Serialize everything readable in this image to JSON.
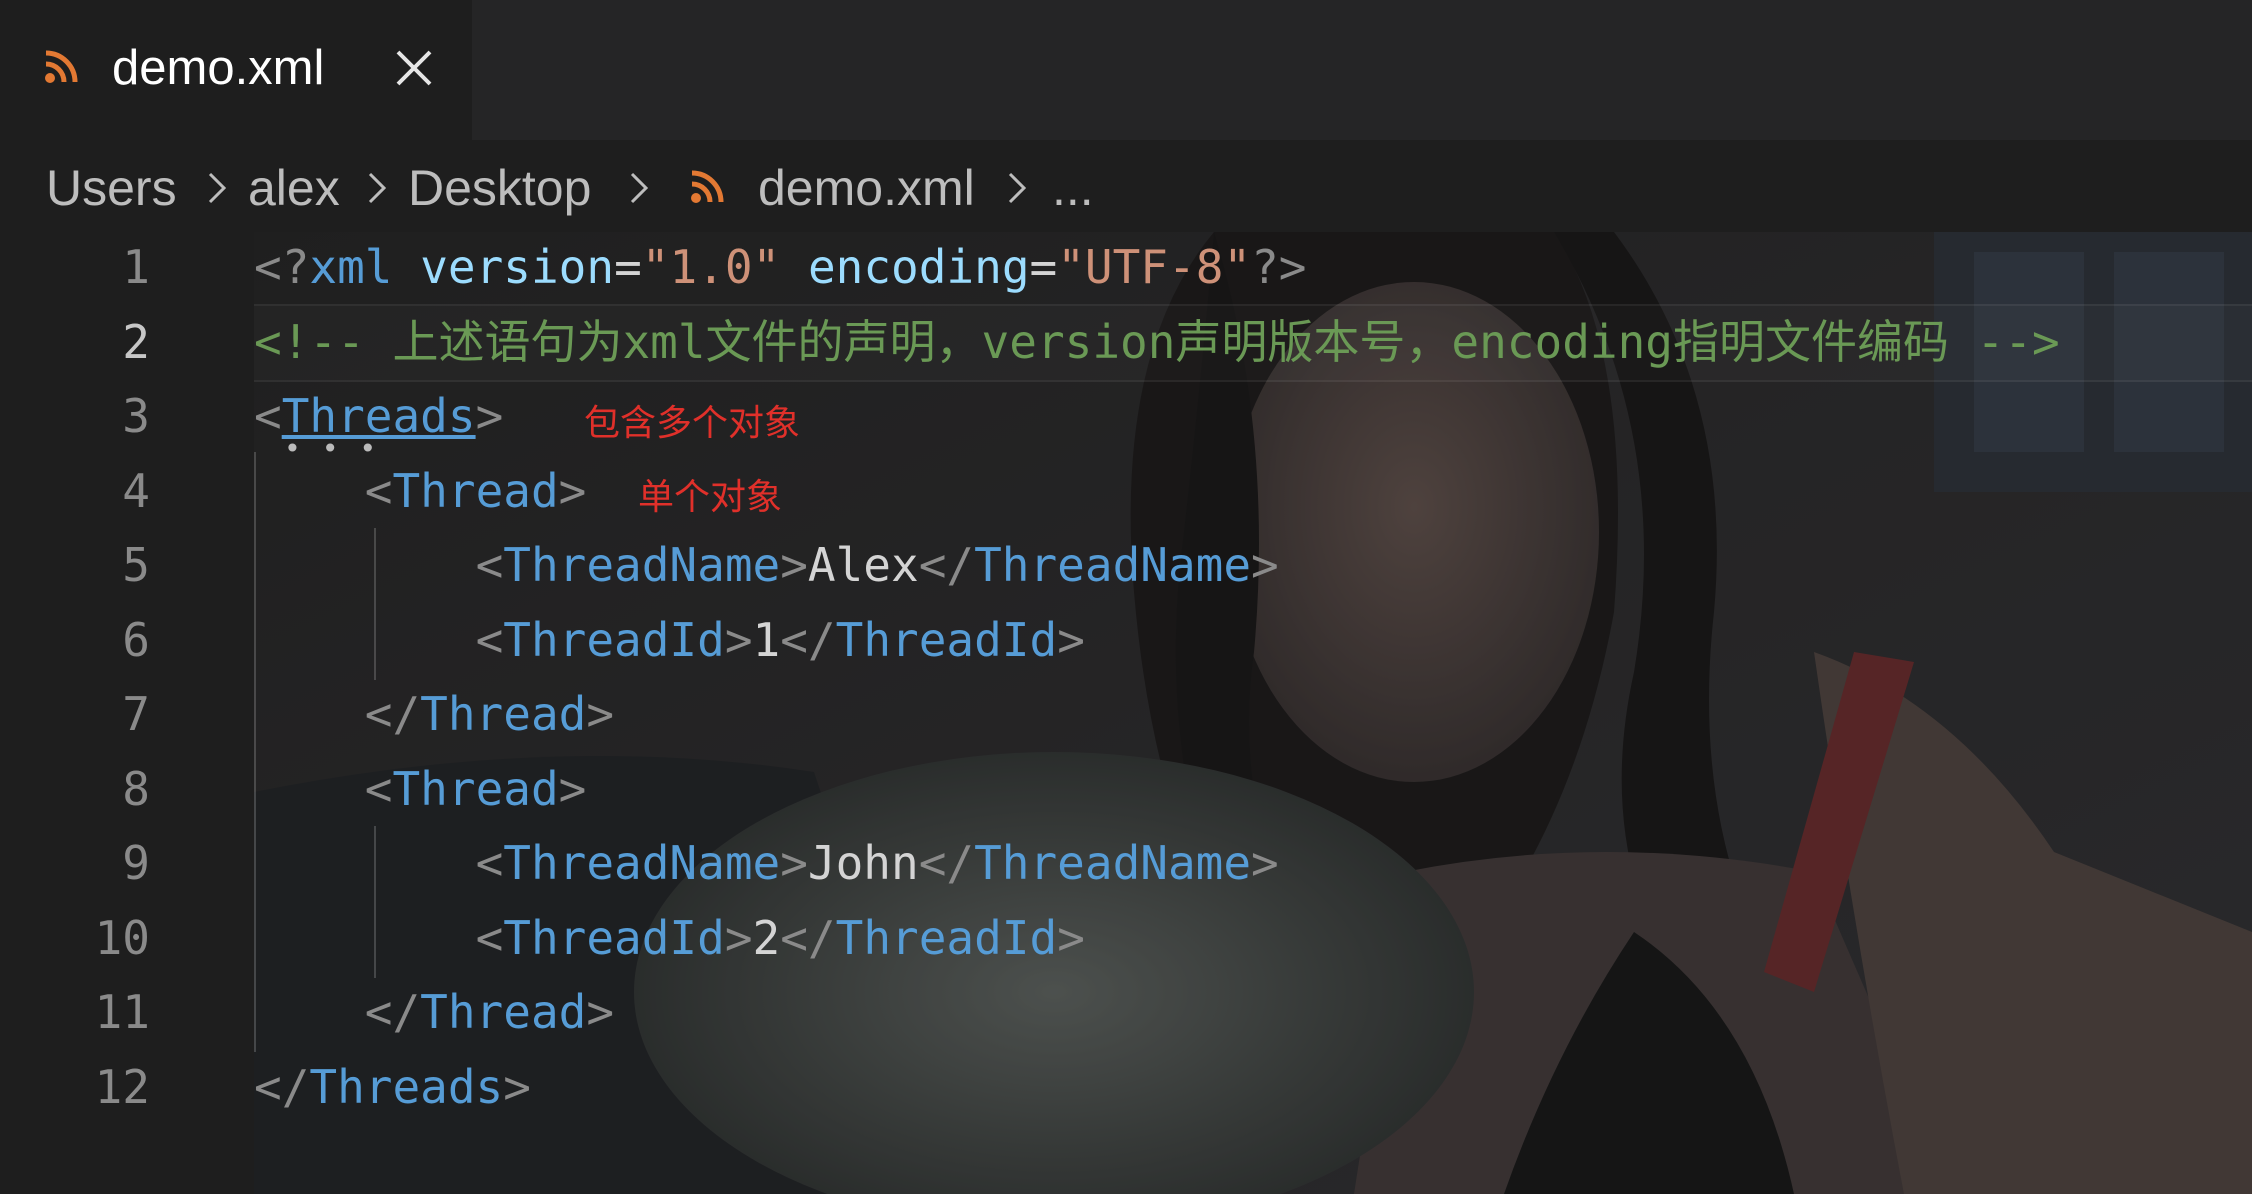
{
  "tab": {
    "icon": "rss-icon",
    "label": "demo.xml",
    "close_icon": "close-icon"
  },
  "breadcrumb": {
    "items": [
      "Users",
      "alex",
      "Desktop",
      "demo.xml",
      "..."
    ],
    "file_icon": "rss-icon",
    "separator_icon": "chevron-right-icon"
  },
  "editor": {
    "line_numbers": [
      "1",
      "2",
      "3",
      "4",
      "5",
      "6",
      "7",
      "8",
      "9",
      "10",
      "11",
      "12"
    ],
    "active_line": "2",
    "lines": [
      {
        "segments": [
          {
            "cls": "p",
            "text": "<?"
          },
          {
            "cls": "t",
            "text": "xml"
          },
          {
            "cls": "x",
            "text": " "
          },
          {
            "cls": "a",
            "text": "version"
          },
          {
            "cls": "x",
            "text": "="
          },
          {
            "cls": "s",
            "text": "\"1.0\""
          },
          {
            "cls": "x",
            "text": " "
          },
          {
            "cls": "a",
            "text": "encoding"
          },
          {
            "cls": "x",
            "text": "="
          },
          {
            "cls": "s",
            "text": "\"UTF-8\""
          },
          {
            "cls": "p",
            "text": "?>"
          }
        ]
      },
      {
        "segments": [
          {
            "cls": "c",
            "text": "<!-- 上述语句为xml文件的声明，version声明版本号，encoding指明文件编码 -->"
          }
        ]
      },
      {
        "segments": [
          {
            "cls": "p",
            "text": "<"
          },
          {
            "cls": "t u",
            "text": "Threads"
          },
          {
            "cls": "p",
            "text": ">"
          }
        ]
      },
      {
        "segments": [
          {
            "cls": "x",
            "text": "    "
          },
          {
            "cls": "p",
            "text": "<"
          },
          {
            "cls": "t",
            "text": "Thread"
          },
          {
            "cls": "p",
            "text": ">"
          }
        ]
      },
      {
        "segments": [
          {
            "cls": "x",
            "text": "        "
          },
          {
            "cls": "p",
            "text": "<"
          },
          {
            "cls": "t",
            "text": "ThreadName"
          },
          {
            "cls": "p",
            "text": ">"
          },
          {
            "cls": "x",
            "text": "Alex"
          },
          {
            "cls": "p",
            "text": "</"
          },
          {
            "cls": "t",
            "text": "ThreadName"
          },
          {
            "cls": "p",
            "text": ">"
          }
        ]
      },
      {
        "segments": [
          {
            "cls": "x",
            "text": "        "
          },
          {
            "cls": "p",
            "text": "<"
          },
          {
            "cls": "t",
            "text": "ThreadId"
          },
          {
            "cls": "p",
            "text": ">"
          },
          {
            "cls": "x",
            "text": "1"
          },
          {
            "cls": "p",
            "text": "</"
          },
          {
            "cls": "t",
            "text": "ThreadId"
          },
          {
            "cls": "p",
            "text": ">"
          }
        ]
      },
      {
        "segments": [
          {
            "cls": "x",
            "text": "    "
          },
          {
            "cls": "p",
            "text": "</"
          },
          {
            "cls": "t",
            "text": "Thread"
          },
          {
            "cls": "p",
            "text": ">"
          }
        ]
      },
      {
        "segments": [
          {
            "cls": "x",
            "text": "    "
          },
          {
            "cls": "p",
            "text": "<"
          },
          {
            "cls": "t",
            "text": "Thread"
          },
          {
            "cls": "p",
            "text": ">"
          }
        ]
      },
      {
        "segments": [
          {
            "cls": "x",
            "text": "        "
          },
          {
            "cls": "p",
            "text": "<"
          },
          {
            "cls": "t",
            "text": "ThreadName"
          },
          {
            "cls": "p",
            "text": ">"
          },
          {
            "cls": "x",
            "text": "John"
          },
          {
            "cls": "p",
            "text": "</"
          },
          {
            "cls": "t",
            "text": "ThreadName"
          },
          {
            "cls": "p",
            "text": ">"
          }
        ]
      },
      {
        "segments": [
          {
            "cls": "x",
            "text": "        "
          },
          {
            "cls": "p",
            "text": "<"
          },
          {
            "cls": "t",
            "text": "ThreadId"
          },
          {
            "cls": "p",
            "text": ">"
          },
          {
            "cls": "x",
            "text": "2"
          },
          {
            "cls": "p",
            "text": "</"
          },
          {
            "cls": "t",
            "text": "ThreadId"
          },
          {
            "cls": "p",
            "text": ">"
          }
        ]
      },
      {
        "segments": [
          {
            "cls": "x",
            "text": "    "
          },
          {
            "cls": "p",
            "text": "</"
          },
          {
            "cls": "t",
            "text": "Thread"
          },
          {
            "cls": "p",
            "text": ">"
          }
        ]
      },
      {
        "segments": [
          {
            "cls": "p",
            "text": "</"
          },
          {
            "cls": "t",
            "text": "Threads"
          },
          {
            "cls": "p",
            "text": ">"
          }
        ]
      }
    ],
    "annotations": {
      "threads_note": "包含多个对象",
      "thread_note": "单个对象"
    },
    "colors": {
      "tag": "#569cd6",
      "attribute": "#9cdcfe",
      "string": "#ce9178",
      "comment": "#6a9955",
      "annotation": "#e0302a",
      "file_icon": "#e37933"
    }
  }
}
